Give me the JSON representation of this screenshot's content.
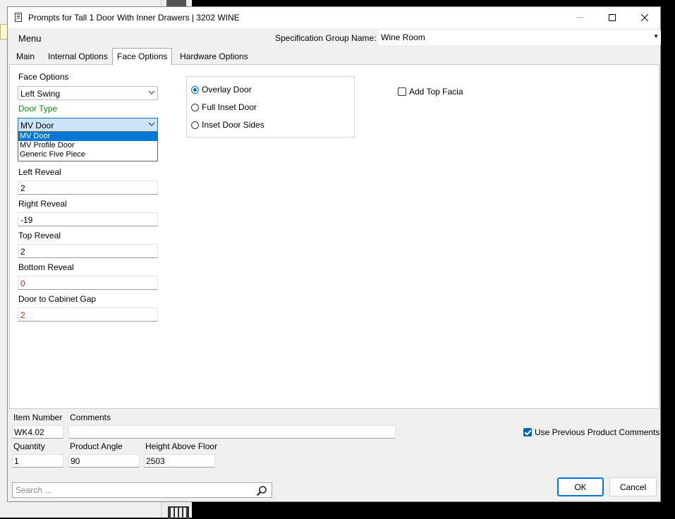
{
  "window": {
    "title": "Prompts for Tall 1 Door With Inner Drawers | 3202 WINE"
  },
  "menubar": {
    "menu_label": "Menu",
    "spec_group_label": "Specification Group Name:",
    "spec_group_value": "Wine Room"
  },
  "tabs": [
    {
      "label": "Main",
      "active": false
    },
    {
      "label": "Internal Options",
      "active": false
    },
    {
      "label": "Face Options",
      "active": true
    },
    {
      "label": "Hardware Options",
      "active": false
    }
  ],
  "face": {
    "face_options_label": "Face Options",
    "face_options_value": "Left Swing",
    "door_type_label": "Door Type",
    "door_type_value": "MV Door",
    "door_type_options": [
      "MV Door",
      "MV Profile Door",
      "Generic Five Piece"
    ],
    "left_reveal_label": "Left Reveal",
    "left_reveal_value": "2",
    "right_reveal_label": "Right Reveal",
    "right_reveal_value": "-19",
    "top_reveal_label": "Top Reveal",
    "top_reveal_value": "2",
    "bottom_reveal_label": "Bottom Reveal",
    "bottom_reveal_value": "0",
    "gap_label": "Door to Cabinet Gap",
    "gap_value": "2"
  },
  "door_style": {
    "options": [
      "Overlay Door",
      "Full Inset Door",
      "Inset Door Sides"
    ],
    "selected": "Overlay Door"
  },
  "add_top_facia": {
    "label": "Add Top Facia",
    "checked": false
  },
  "bottom": {
    "item_number_label": "Item Number",
    "item_number_value": "WK4.02",
    "comments_label": "Comments",
    "comments_value": "",
    "use_prev_comments_label": "Use Previous Product Comments",
    "use_prev_comments_checked": true,
    "quantity_label": "Quantity",
    "quantity_value": "1",
    "product_angle_label": "Product Angle",
    "product_angle_value": "90",
    "height_label": "Height Above Floor",
    "height_value": "2503",
    "search_placeholder": "Search ...",
    "ok_label": "OK",
    "cancel_label": "Cancel"
  },
  "colors": {
    "accent": "#0078d7",
    "label_green": "#138a13",
    "value_red": "#e02020"
  }
}
